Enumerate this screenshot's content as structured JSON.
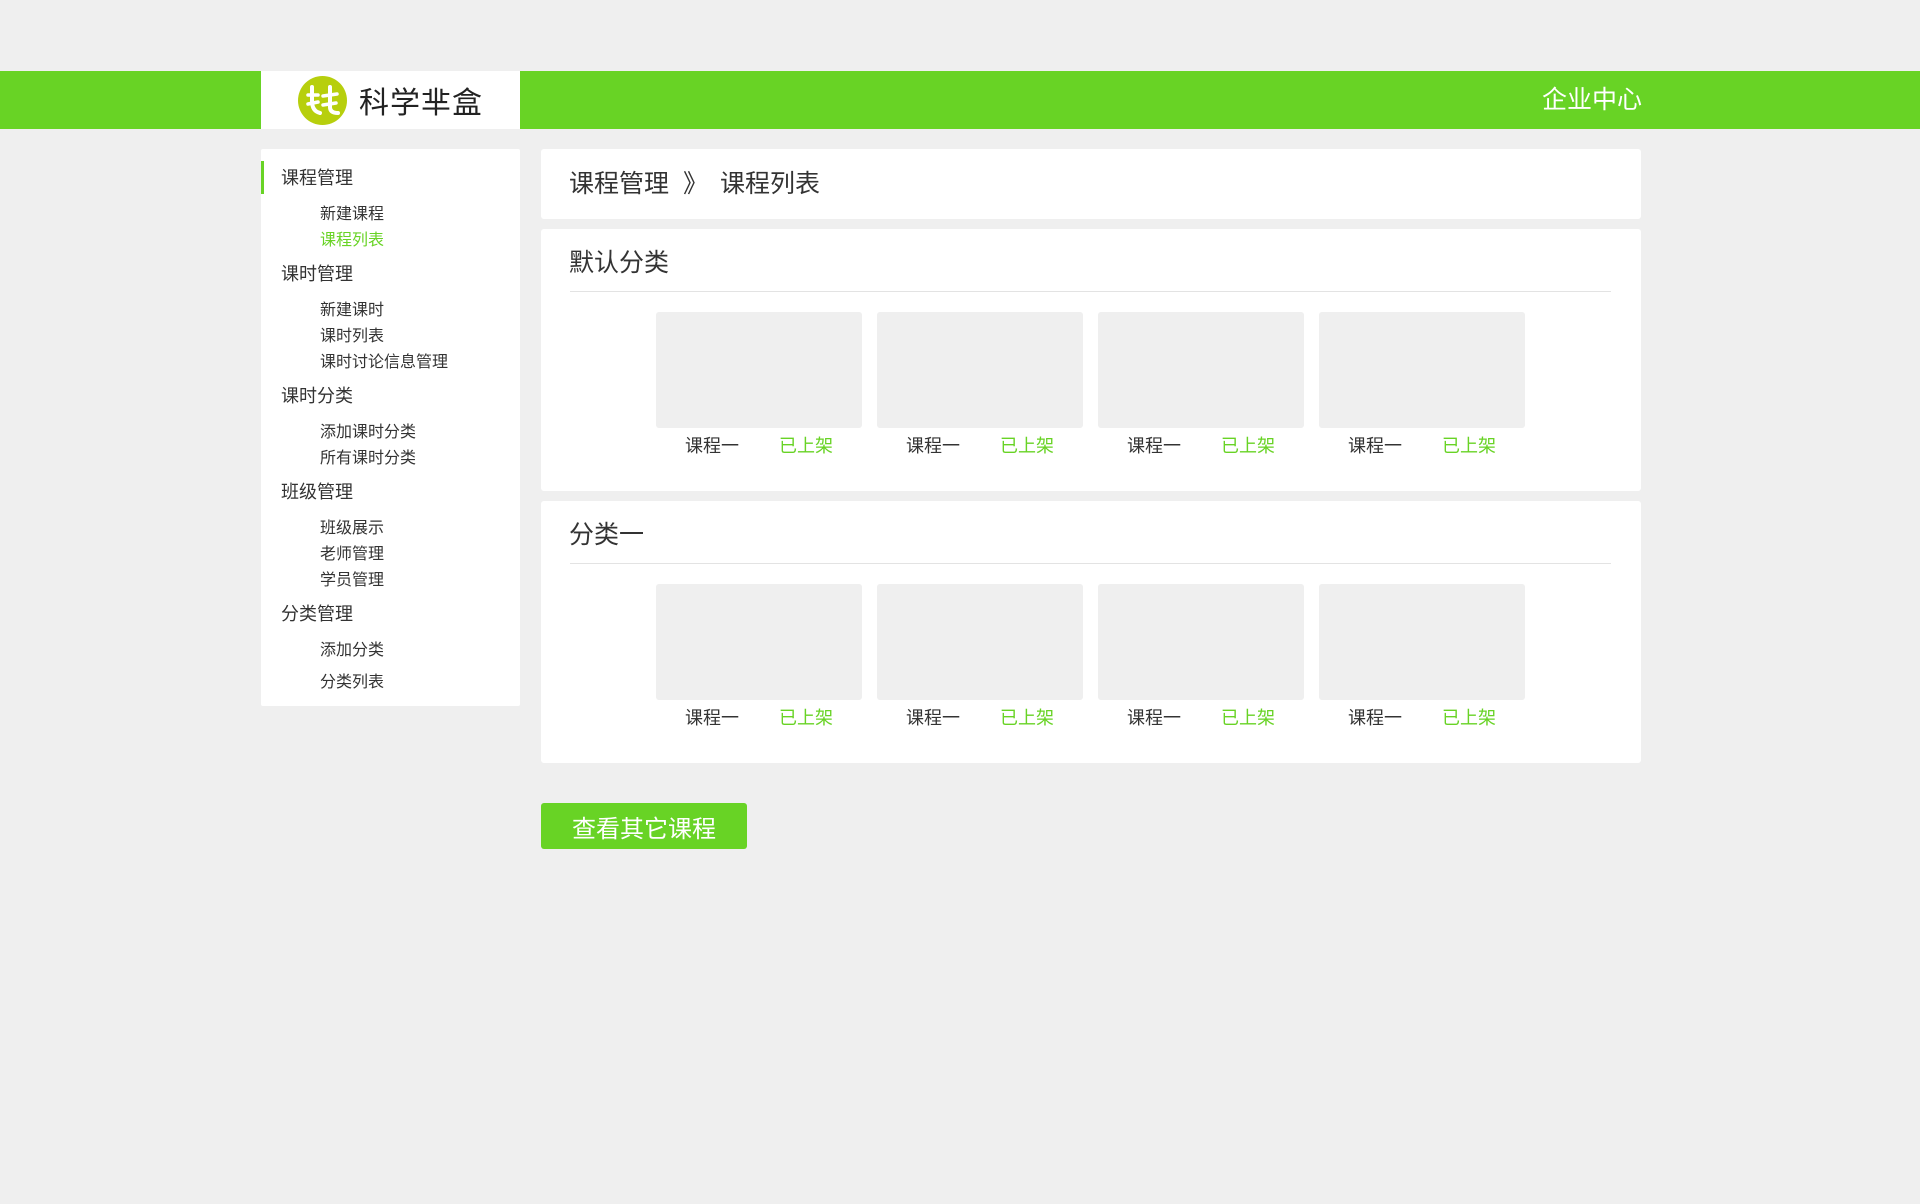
{
  "header": {
    "brand": "科学芈盒",
    "link": "企业中心",
    "color": "#68d325"
  },
  "sidebar": {
    "groups": [
      {
        "title": "课程管理",
        "items": [
          "新建课程",
          "课程列表"
        ]
      },
      {
        "title": "课时管理",
        "items": [
          "新建课时",
          "课时列表",
          "课时讨论信息管理"
        ]
      },
      {
        "title": "课时分类",
        "items": [
          "添加课时分类",
          "所有课时分类"
        ]
      },
      {
        "title": "班级管理",
        "items": [
          "班级展示",
          "老师管理",
          "学员管理"
        ]
      },
      {
        "title": "分类管理",
        "items": [
          "添加分类",
          "分类列表"
        ]
      }
    ],
    "active_item": "课程列表"
  },
  "breadcrumb": {
    "section": "课程管理",
    "separator": "》",
    "page": "课程列表"
  },
  "categories": [
    {
      "title": "默认分类",
      "courses": [
        {
          "name": "课程一",
          "status": "已上架"
        },
        {
          "name": "课程一",
          "status": "已上架"
        },
        {
          "name": "课程一",
          "status": "已上架"
        },
        {
          "name": "课程一",
          "status": "已上架"
        }
      ]
    },
    {
      "title": "分类一",
      "courses": [
        {
          "name": "课程一",
          "status": "已上架"
        },
        {
          "name": "课程一",
          "status": "已上架"
        },
        {
          "name": "课程一",
          "status": "已上架"
        },
        {
          "name": "课程一",
          "status": "已上架"
        }
      ]
    }
  ],
  "more_button": "查看其它课程"
}
